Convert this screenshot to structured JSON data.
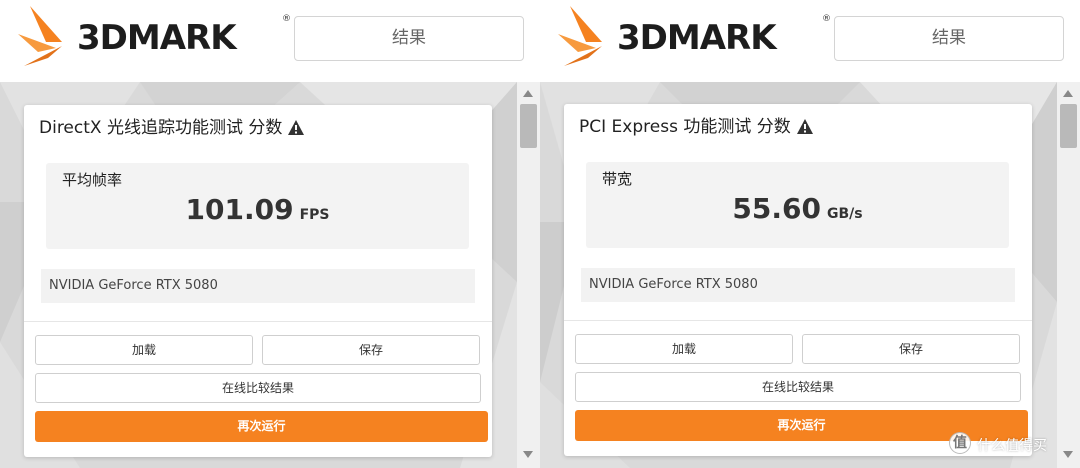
{
  "brand": {
    "logo_text": "3DMARK",
    "registered_mark": "®"
  },
  "colors": {
    "accent": "#F58220",
    "background": "#D9D9D9",
    "card": "#FFFFFF"
  },
  "watermark": {
    "text": "值 什么值得买",
    "icon_char": "值",
    "label": "什么值得买"
  },
  "panels": [
    {
      "tab_label": "结果",
      "card": {
        "title": "DirectX 光线追踪功能测试 分数",
        "warning_icon": "warning-triangle-icon",
        "metric_label": "平均帧率",
        "metric_value": "101.09",
        "metric_unit": "FPS",
        "device": "NVIDIA GeForce RTX 5080"
      },
      "buttons": {
        "load": "加载",
        "save": "保存",
        "compare": "在线比较结果",
        "run_again": "再次运行"
      }
    },
    {
      "tab_label": "结果",
      "card": {
        "title": "PCI Express 功能测试 分数",
        "warning_icon": "warning-triangle-icon",
        "metric_label": "带宽",
        "metric_value": "55.60",
        "metric_unit": "GB/s",
        "device": "NVIDIA GeForce RTX 5080"
      },
      "buttons": {
        "load": "加载",
        "save": "保存",
        "compare": "在线比较结果",
        "run_again": "再次运行"
      }
    }
  ]
}
